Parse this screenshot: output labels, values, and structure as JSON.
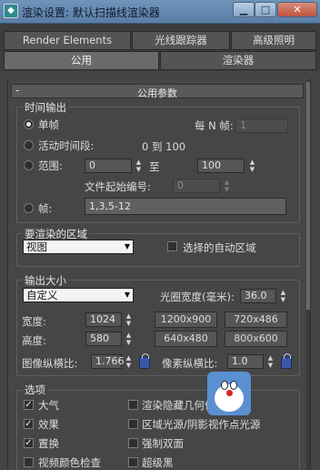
{
  "window": {
    "title": "渲染设置: 默认扫描线渲染器",
    "minimize_glyph": "▁",
    "maximize_glyph": "□",
    "close_glyph": "✕"
  },
  "tabs": {
    "row1": [
      "Render Elements",
      "光线跟踪器",
      "高级照明"
    ],
    "row2": [
      "公用",
      "渲染器"
    ],
    "active": "公用"
  },
  "rollout": {
    "collapse_glyph": "-",
    "title": "公用参数"
  },
  "time_output": {
    "title": "时间输出",
    "single": "单帧",
    "every_n_label": "每 N 帧:",
    "every_n_value": "1",
    "active_segment": "活动时间段:",
    "active_range": "0 到 100",
    "range": "范围:",
    "range_from": "0",
    "range_to_label": "至",
    "range_to": "100",
    "file_start_label": "文件起始编号:",
    "file_start_value": "0",
    "frames_label": "帧:",
    "frames_value": "1,3,5-12",
    "selected": "单帧"
  },
  "render_area": {
    "title": "要渲染的区域",
    "dropdown_value": "视图",
    "auto_region_label": "选择的自动区域",
    "auto_region_checked": false
  },
  "output_size": {
    "title": "输出大小",
    "preset_value": "自定义",
    "aperture_label": "光圈宽度(毫米):",
    "aperture_value": "36.0",
    "width_label": "宽度:",
    "width_value": "1024",
    "height_label": "高度:",
    "height_value": "580",
    "presets": [
      "1200x900",
      "720x486",
      "640x480",
      "800x600"
    ],
    "image_aspect_label": "图像纵横比:",
    "image_aspect_value": "1.766",
    "pixel_aspect_label": "像素纵横比:",
    "pixel_aspect_value": "1.0"
  },
  "options": {
    "title": "选项",
    "items": [
      {
        "label": "大气",
        "checked": true
      },
      {
        "label": "效果",
        "checked": true
      },
      {
        "label": "置换",
        "checked": true
      },
      {
        "label": "视频颜色检查",
        "checked": false
      },
      {
        "label": "渲染隐藏几何体",
        "checked": false
      },
      {
        "label": "区域光源/阴影视作点光源",
        "checked": false
      },
      {
        "label": "强制双面",
        "checked": false
      },
      {
        "label": "超级黑",
        "checked": false
      }
    ]
  },
  "colors": {
    "titlebar": "#6f93b9",
    "panel": "#464646",
    "accent": "#5a8fd1"
  }
}
